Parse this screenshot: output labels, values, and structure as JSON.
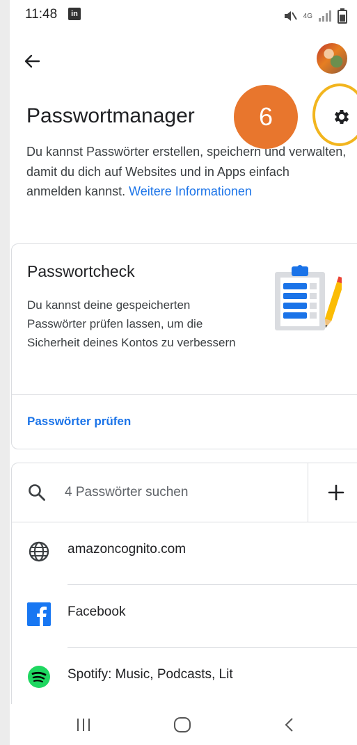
{
  "status_bar": {
    "time": "11:48",
    "notification_icon": "linkedin-icon",
    "notification_label": "in",
    "network_label": "4G",
    "icons": [
      "mute-icon",
      "signal-icon",
      "battery-icon"
    ]
  },
  "app_bar": {
    "back_icon": "arrow-back-icon",
    "avatar": "profile-avatar"
  },
  "header": {
    "title": "Passwortmanager",
    "step_number": "6",
    "settings_icon": "gear-icon",
    "highlight_color": "#f2b51e",
    "badge_color": "#e8762d"
  },
  "intro": {
    "text": "Du kannst Passwörter erstellen, speichern und verwalten, damit du dich auf Websites und in Apps einfach anmelden kannst.",
    "link": "Weitere Informationen"
  },
  "password_check": {
    "title": "Passwortcheck",
    "description": "Du kannst deine gespeicherten Passwörter prüfen lassen, um die Sicherheit deines Kontos zu verbessern",
    "illustration": "clipboard-pencil-illustration",
    "action": "Passwörter prüfen"
  },
  "search": {
    "placeholder": "4 Passwörter suchen",
    "icon": "search-icon",
    "add_icon": "plus-icon"
  },
  "passwords": [
    {
      "label": "amazoncognito.com",
      "icon": "globe-icon"
    },
    {
      "label": "Facebook",
      "icon": "facebook-icon"
    },
    {
      "label": "Spotify: Music, Podcasts, Lit",
      "icon": "spotify-icon"
    }
  ],
  "nav_bar": {
    "buttons": [
      "recent-apps-icon",
      "home-icon",
      "back-nav-icon"
    ]
  },
  "colors": {
    "link": "#1a73e8",
    "text_primary": "#202124",
    "divider": "#dadce0"
  }
}
